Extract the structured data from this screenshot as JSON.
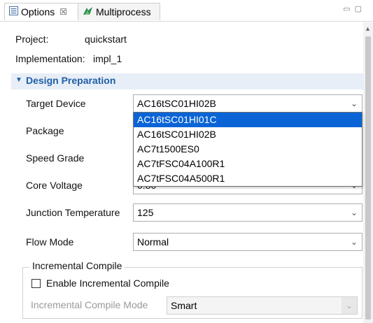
{
  "tabs": [
    {
      "label": "Options",
      "close": "☒",
      "icon": "options-icon"
    },
    {
      "label": "Multiprocess",
      "icon": "multiprocess-icon"
    }
  ],
  "project": {
    "label": "Project:",
    "value": "quickstart"
  },
  "implementation": {
    "label": "Implementation:",
    "value": "impl_1"
  },
  "section": {
    "title": "Design Preparation",
    "expanded": true
  },
  "fields": {
    "target_device": {
      "label": "Target Device",
      "value": "AC16tSC01HI02B"
    },
    "package": {
      "label": "Package"
    },
    "speed_grade": {
      "label": "Speed Grade"
    },
    "core_voltage": {
      "label": "Core Voltage",
      "value": "0.80"
    },
    "junction_temp": {
      "label": "Junction Temperature",
      "value": "125"
    },
    "flow_mode": {
      "label": "Flow Mode",
      "value": "Normal"
    }
  },
  "dropdown": {
    "options": [
      "AC16tSC01HI01C",
      "AC16tSC01HI02B",
      "AC7t1500ES0",
      "AC7tFSC04A100R1",
      "AC7tFSC04A500R1"
    ],
    "highlighted_index": 0
  },
  "incremental": {
    "group_title": "Incremental Compile",
    "enable_label": "Enable Incremental Compile",
    "enable_checked": false,
    "mode_label": "Incremental Compile Mode",
    "mode_value": "Smart"
  },
  "colors": {
    "accent": "#1f5fa8",
    "selection": "#0a64d6"
  }
}
